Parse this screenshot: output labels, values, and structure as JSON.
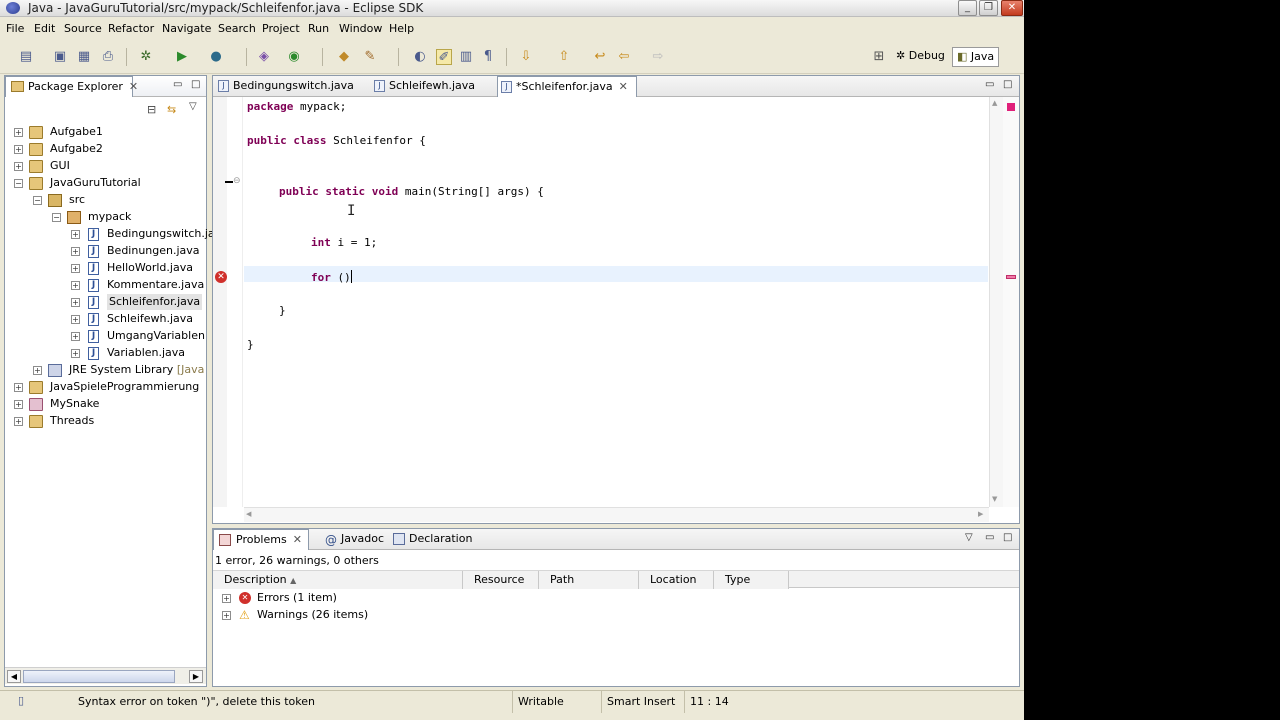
{
  "window": {
    "title": "Java - JavaGuruTutorial/src/mypack/Schleifenfor.java - Eclipse SDK",
    "minimize": "_",
    "restore": "❐",
    "close": "✕"
  },
  "menu": [
    "File",
    "Edit",
    "Source",
    "Refactor",
    "Navigate",
    "Search",
    "Project",
    "Run",
    "Window",
    "Help"
  ],
  "perspectives": {
    "debug": "Debug",
    "java": "Java"
  },
  "package_explorer": {
    "title": "Package Explorer",
    "close": "✕",
    "items": [
      {
        "label": "Aufgabe1",
        "suffix": ""
      },
      {
        "label": "Aufgabe2",
        "suffix": ""
      },
      {
        "label": "GUI",
        "suffix": ""
      },
      {
        "label": "JavaGuruTutorial",
        "suffix": ""
      },
      {
        "label": "src",
        "suffix": ""
      },
      {
        "label": "mypack",
        "suffix": ""
      },
      {
        "label": "Bedingungswitch.jav",
        "suffix": ""
      },
      {
        "label": "Bedinungen.java",
        "suffix": ""
      },
      {
        "label": "HelloWorld.java",
        "suffix": ""
      },
      {
        "label": "Kommentare.java",
        "suffix": ""
      },
      {
        "label": "Schleifenfor.java",
        "suffix": ""
      },
      {
        "label": "Schleifewh.java",
        "suffix": ""
      },
      {
        "label": "UmgangVariablen.jav",
        "suffix": ""
      },
      {
        "label": "Variablen.java",
        "suffix": ""
      },
      {
        "label": "JRE System Library",
        "suffix": "[JavaSE-"
      },
      {
        "label": "JavaSpieleProgrammierung",
        "suffix": ""
      },
      {
        "label": "MySnake",
        "suffix": ""
      },
      {
        "label": "Threads",
        "suffix": ""
      }
    ],
    "selected": "Schleifenfor.java"
  },
  "editor": {
    "tabs": [
      {
        "label": "Bedingungswitch.java",
        "active": false
      },
      {
        "label": "Schleifewh.java",
        "active": false
      },
      {
        "label": "*Schleifenfor.java",
        "active": true
      }
    ],
    "close": "✕",
    "lines": [
      {
        "kw": "package",
        "rest": " mypack;"
      },
      {
        "kw": "public class",
        "rest": " Schleifenfor {"
      },
      {
        "kw": "public static void",
        "rest": " main(String[] args) {"
      },
      {
        "kw": "int",
        "rest": " i = 1;"
      },
      {
        "kw": "for",
        "rest": " ()"
      },
      {
        "kw": "",
        "rest": "}"
      },
      {
        "kw": "",
        "rest": "}"
      }
    ]
  },
  "problems": {
    "tabs": [
      "Problems",
      "Javadoc",
      "Declaration"
    ],
    "summary": "1 error, 26 warnings, 0 others",
    "columns": [
      "Description",
      "Resource",
      "Path",
      "Location",
      "Type"
    ],
    "rows": [
      {
        "label": "Errors (1 item)",
        "kind": "error"
      },
      {
        "label": "Warnings (26 items)",
        "kind": "warning"
      }
    ]
  },
  "status": {
    "message": "Syntax error on token \")\", delete this token",
    "writable": "Writable",
    "insert_mode": "Smart Insert",
    "position": "11 : 14"
  },
  "colors": {
    "keyword": "#7f0055",
    "current_line": "#e8f2fe",
    "error": "#d0302b",
    "warning": "#e3a21a"
  }
}
